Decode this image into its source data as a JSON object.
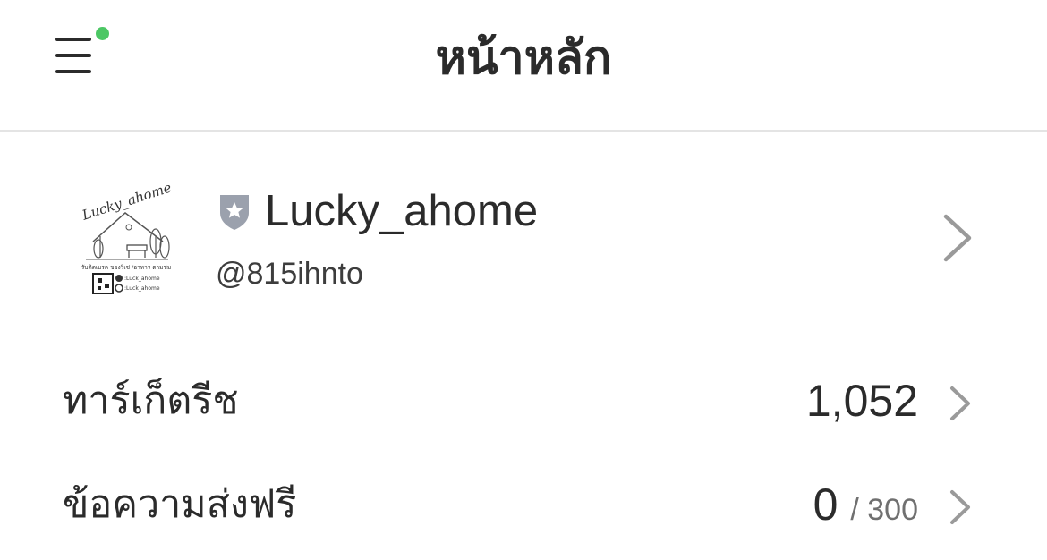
{
  "header": {
    "title": "หน้าหลัก",
    "menu_icon": "hamburger-menu-icon",
    "notification_dot_color": "#4cc764"
  },
  "account": {
    "name": "Lucky_ahome",
    "id": "@815ihnto",
    "badge_icon": "verified-shield-star-icon",
    "avatar": {
      "logo_text": "Lucky_ahome",
      "tagline": "รับติดเบรค ของวิเซ่ /อาหาร ตามชม",
      "social_facebook": ":Luck_ahome",
      "social_instagram": ":Luck_ahome"
    }
  },
  "stats": [
    {
      "label": "ทาร์เก็ตรีช",
      "value": "1,052",
      "limit": ""
    },
    {
      "label": "ข้อความส่งฟรี",
      "value": "0",
      "limit": "/ 300"
    }
  ],
  "colors": {
    "text": "#2b2b2b",
    "secondary_text": "#707070",
    "chevron": "#9a9a9a",
    "divider": "#e4e4e4",
    "badge": "#9ba1ad"
  }
}
